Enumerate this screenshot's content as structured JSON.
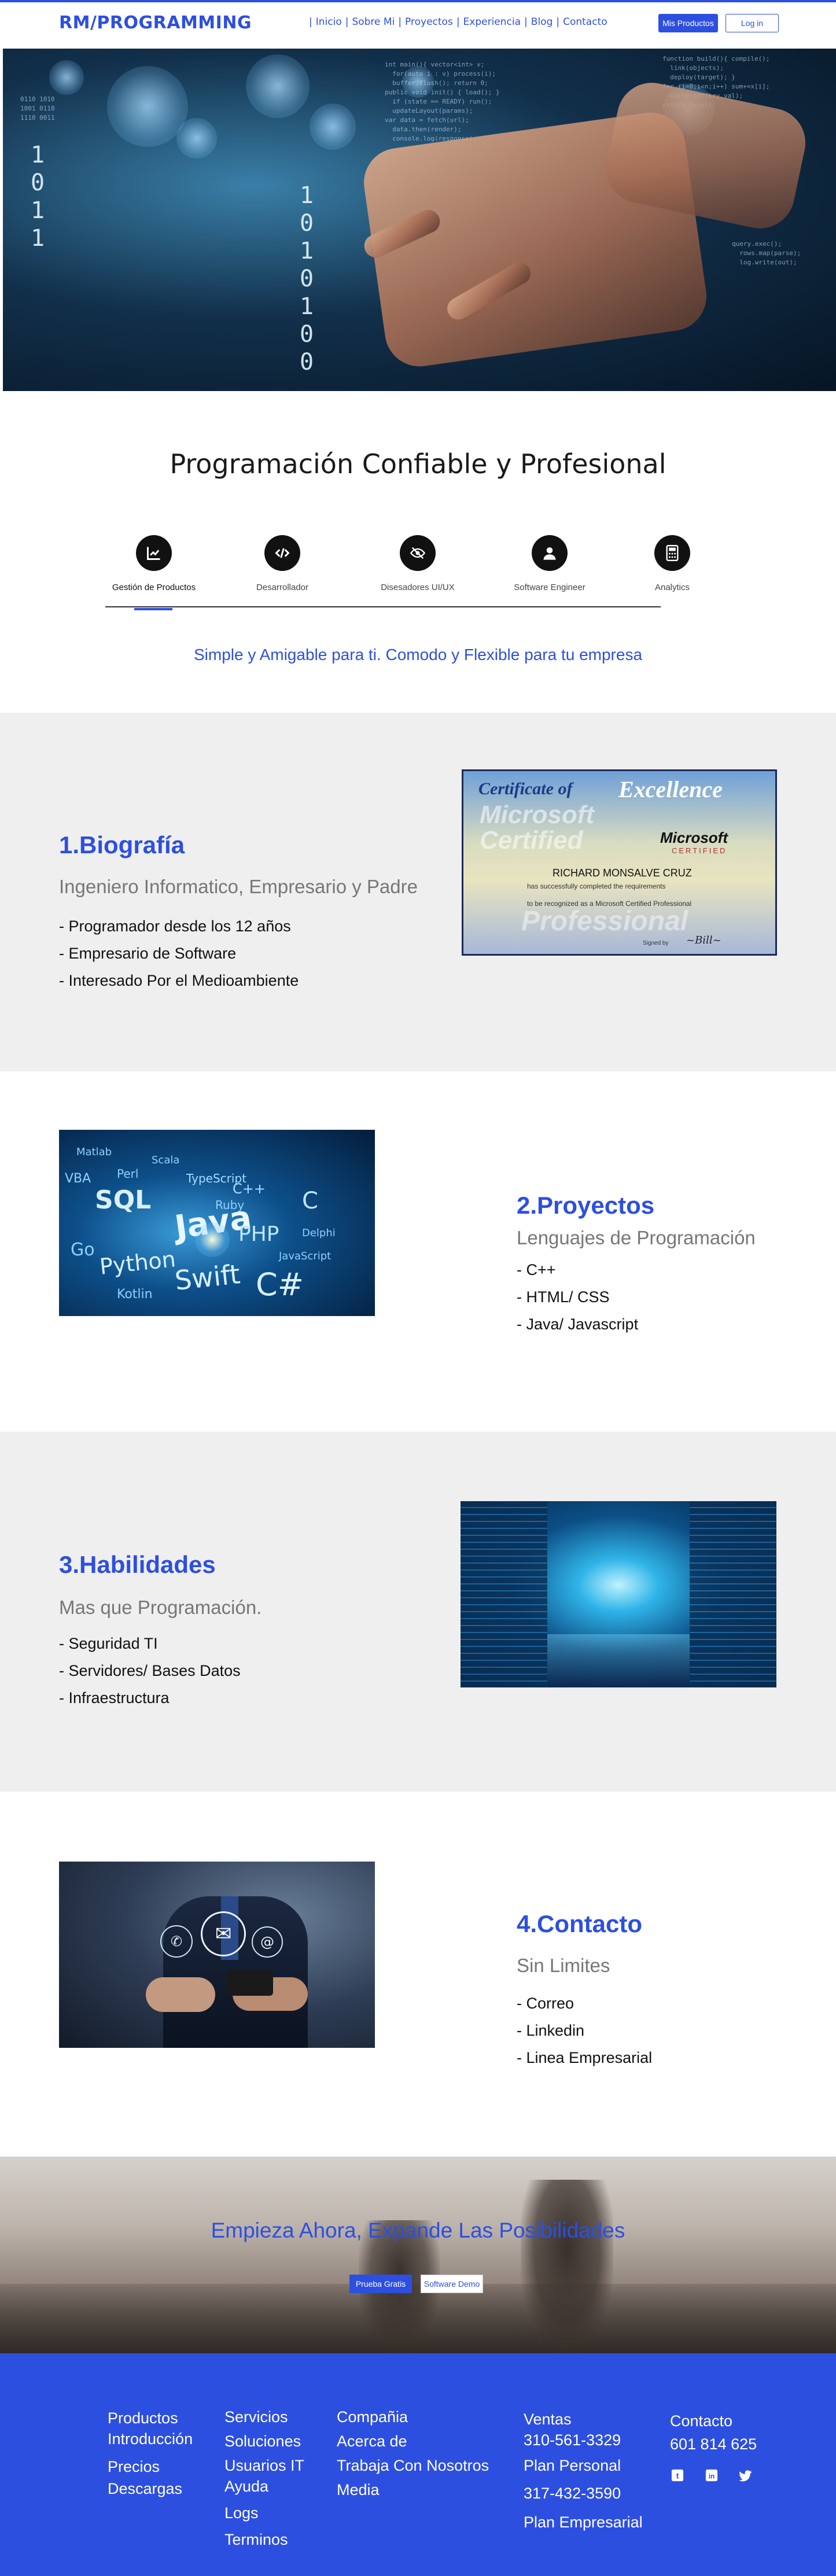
{
  "header": {
    "brand": "RM/PROGRAMMING",
    "nav": [
      "Inicio",
      "Sobre Mi",
      "Proyectos",
      "Experiencia",
      "Blog",
      "Contacto"
    ],
    "products_button": "Mis Productos",
    "login_button": "Log in"
  },
  "hero": {
    "digits_left": [
      "1",
      "0",
      "1",
      "1"
    ],
    "digits_center": [
      "1",
      "0",
      "1",
      "0",
      "1",
      "0",
      "0"
    ]
  },
  "intro": {
    "title": "Programación Confiable y Profesional",
    "features": [
      {
        "label": "Gestión de Productos",
        "icon": "chart-line-icon"
      },
      {
        "label": "Desarrollador",
        "icon": "code-icon"
      },
      {
        "label": "Disesadores UI/UX",
        "icon": "eye-slash-icon"
      },
      {
        "label": "Software Engineer",
        "icon": "user-icon"
      },
      {
        "label": "Analytics",
        "icon": "calculator-icon"
      }
    ],
    "tagline": "Simple y Amigable para ti. Comodo y Flexible  para tu empresa"
  },
  "sections": {
    "bio": {
      "heading": "1.Biografía",
      "subtitle": "Ingeniero Informatico,  Empresario y Padre",
      "items": [
        "- Programador desde los 12 años",
        "- Empresario de Software",
        "- Interesado Por el Medioambiente"
      ],
      "certificate": {
        "title_a": "Certificate of",
        "title_b": "Excellence",
        "microsoft": "Microsoft",
        "certified": "CERTIFIED",
        "name": "RICHARD MONSALVE CRUZ",
        "line1": "has successfully completed the requirements",
        "line2": "to be recognized as a Microsoft Certified Professional",
        "signed": "Signed by"
      }
    },
    "projects": {
      "heading": "2.Proyectos",
      "subtitle": "Lenguajes de Programación",
      "items": [
        "- C++",
        "- HTML/ CSS",
        "- Java/ Javascript"
      ],
      "image_words": [
        "Matlab",
        "Scala",
        "TypeScript",
        "C++",
        "VBA",
        "Perl",
        "Ruby",
        "SQL",
        "Java",
        "C",
        "Go",
        "PHP",
        "Delphi",
        "Python",
        "Swift",
        "JavaScript",
        "Kotlin",
        "C#"
      ]
    },
    "skills": {
      "heading": "3.Habilidades",
      "subtitle": "Mas que Programación.",
      "items": [
        "- Seguridad TI",
        "- Servidores/ Bases Datos",
        "- Infraestructura"
      ]
    },
    "contact": {
      "heading": "4.Contacto",
      "subtitle": "Sin Limites",
      "items": [
        "- Correo",
        "- Linkedin",
        "- Linea Empresarial"
      ]
    }
  },
  "cta": {
    "title": "Empieza Ahora, Expande Las Posibilidades",
    "primary_button": "Prueba Gratis",
    "secondary_button": "Software Demo"
  },
  "footer": {
    "col1": [
      "Productos",
      "Introducción",
      "Precios",
      "Descargas"
    ],
    "col2": [
      "Servicios",
      "Soluciones",
      "Usuarios IT",
      "Ayuda",
      "Logs",
      "Terminos"
    ],
    "col3": [
      "Compañia",
      "Acerca de",
      "Trabaja Con Nosotros",
      "Media"
    ],
    "col4": [
      "Ventas",
      "310-561-3329",
      "Plan Personal",
      "317-432-3590",
      "Plan Empresarial"
    ],
    "col5": {
      "heading": "Contacto",
      "phone": "601 814 625"
    },
    "social": [
      "tumblr-icon",
      "linkedin-icon",
      "twitter-icon"
    ]
  },
  "colors": {
    "accent": "#2d4fe0",
    "section_grey": "#efefef",
    "footer": "#2d4fe0"
  }
}
